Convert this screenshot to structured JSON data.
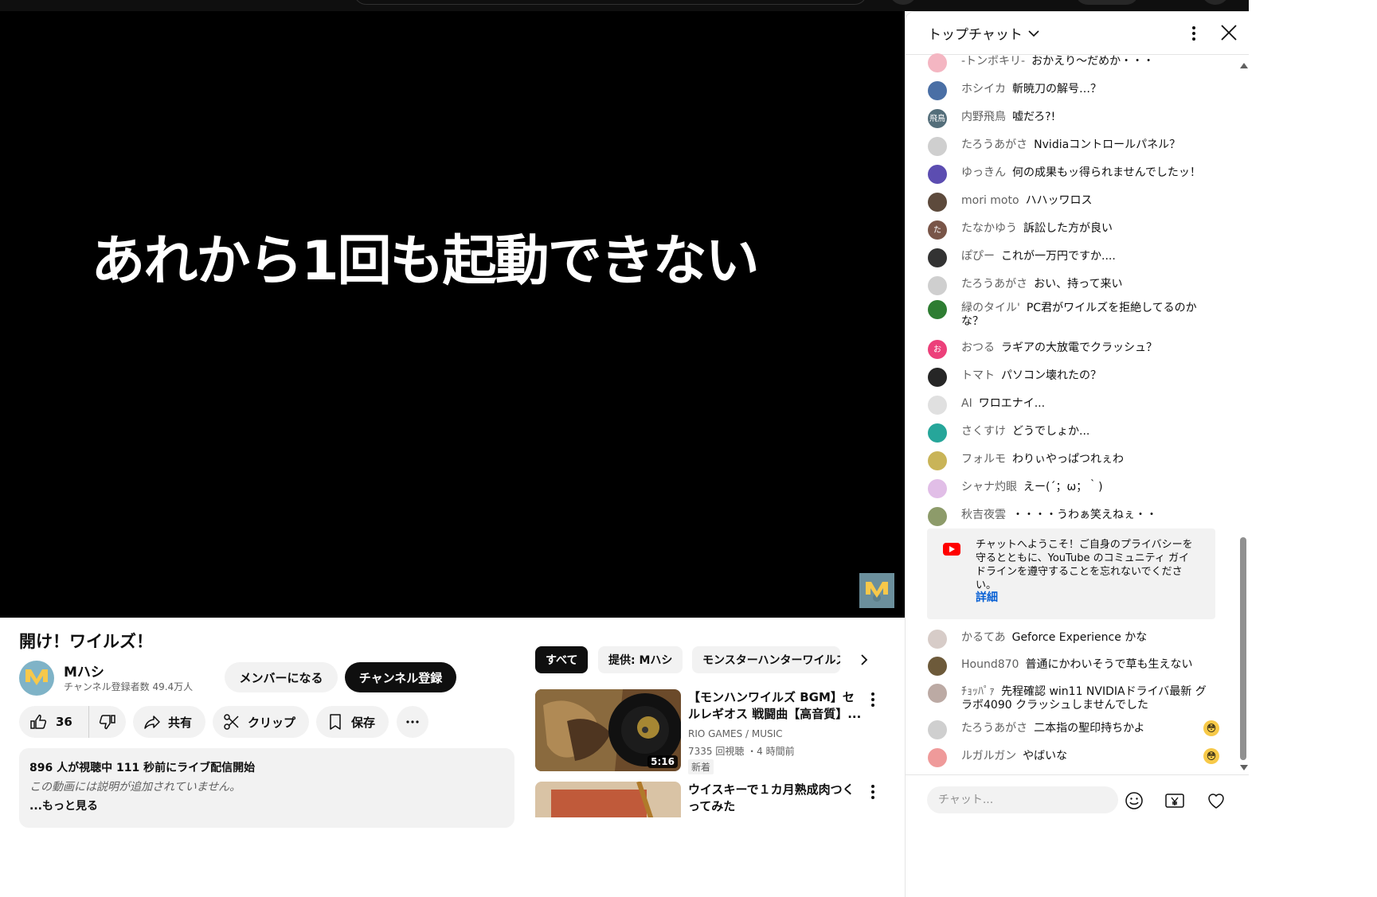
{
  "player": {
    "caption": "あれから1回も起動できない"
  },
  "video": {
    "title": "開け！ワイルズ！",
    "channel_name": "Mハシ",
    "subscribers": "チャンネル登録者数 49.4万人",
    "member_label": "メンバーになる",
    "subscribe_label": "チャンネル登録",
    "like_count": "36",
    "share_label": "共有",
    "clip_label": "クリップ",
    "save_label": "保存"
  },
  "description": {
    "stats": "896 人が視聴中  111 秒前にライブ配信開始",
    "text": "この動画には説明が追加されていません。",
    "more": "...もっと見る"
  },
  "chips": [
    "すべて",
    "提供: Mハシ",
    "モンスターハンターワイルズ"
  ],
  "related": [
    {
      "title": "【モンハンワイルズ BGM】セルレギオス 戦闘曲【高音質】...",
      "channel": "RIO GAMES / MUSIC",
      "meta": "7335 回視聴 ・4 時間前",
      "badge": "新着",
      "duration": "5:16"
    },
    {
      "title": "ウイスキーで１カ月熟成肉つくってみた",
      "channel": "",
      "meta": "",
      "badge": "",
      "duration": ""
    }
  ],
  "chat": {
    "title": "トップチャット",
    "messages": [
      {
        "author": "-トンボキリ-",
        "text": "おかえり〜だめか・・・",
        "avatar_color": "#f4b6c2",
        "avatar_text": ""
      },
      {
        "author": "ホシイカ",
        "text": "斬暁刀の解号…？",
        "avatar_color": "#4a6fa5",
        "avatar_text": ""
      },
      {
        "author": "内野飛鳥",
        "text": "嘘だろ?!",
        "avatar_color": "#546e7a",
        "avatar_text": "飛鳥"
      },
      {
        "author": "たろうあがさ",
        "text": "Nvidiaコントロールパネル？",
        "avatar_color": "#cfcfcf",
        "avatar_text": ""
      },
      {
        "author": "ゆっきん",
        "text": "何の成果もッ得られませんでしたッ！",
        "avatar_color": "#5c4db1",
        "avatar_text": ""
      },
      {
        "author": "mori moto",
        "text": "ハハッワロス",
        "avatar_color": "#5d4a3c",
        "avatar_text": ""
      },
      {
        "author": "たなかゆう",
        "text": "訴訟した方が良い",
        "avatar_color": "#795548",
        "avatar_text": "た"
      },
      {
        "author": "ぽぴー",
        "text": "これが一万円ですか....",
        "avatar_color": "#333333",
        "avatar_text": ""
      },
      {
        "author": "たろうあがさ",
        "text": "おい、持って来い",
        "avatar_color": "#cfcfcf",
        "avatar_text": ""
      },
      {
        "author": "緑のタイル'",
        "text": "PC君がワイルズを拒絶してるのかな？",
        "avatar_color": "#2e7d32",
        "avatar_text": ""
      },
      {
        "author": "おつる",
        "text": "ラギアの大放電でクラッシュ？",
        "avatar_color": "#ec407a",
        "avatar_text": "お"
      },
      {
        "author": "トマト",
        "text": "パソコン壊れたの？",
        "avatar_color": "#262626",
        "avatar_text": ""
      },
      {
        "author": "AI",
        "text": "ワロエナイ...",
        "avatar_color": "#e0e0e0",
        "avatar_text": ""
      },
      {
        "author": "さくすけ",
        "text": "どうでしょか...",
        "avatar_color": "#26a69a",
        "avatar_text": ""
      },
      {
        "author": "フォルモ",
        "text": "わりぃやっぱつれぇわ",
        "avatar_color": "#c9b458",
        "avatar_text": ""
      },
      {
        "author": "シャナ灼眼",
        "text": "えー(´；ω；｀)",
        "avatar_color": "#e1bee7",
        "avatar_text": ""
      },
      {
        "author": "秋吉夜雲",
        "text": "・・・・うわぁ笑えねぇ・・",
        "avatar_color": "#8d9b6a",
        "avatar_text": ""
      }
    ],
    "welcome_text": "チャットへようこそ！ご自身のプライバシーを守るとともに、YouTube のコミュニティ ガイドラインを遵守することを忘れないでください。",
    "welcome_more": "詳細",
    "messages_after": [
      {
        "author": "かるてあ",
        "text": "Geforce Experience かな",
        "avatar_color": "#d7ccc8",
        "avatar_text": "",
        "emoji": ""
      },
      {
        "author": "Hound870",
        "text": "普通にかわいそうで草も生えない",
        "avatar_color": "#6d5a3a",
        "avatar_text": "",
        "emoji": ""
      },
      {
        "author": "ﾁｮｯﾊﾟｧ",
        "text": "先程確認 win11 NVIDIAドライバ最新 グラボ4090 クラッシュしませんでした",
        "avatar_color": "#bcaaa4",
        "avatar_text": "",
        "emoji": ""
      },
      {
        "author": "たろうあがさ",
        "text": "二本指の聖印持ちかよ",
        "avatar_color": "#cfcfcf",
        "avatar_text": "",
        "emoji": "😳"
      },
      {
        "author": "ルガルガン",
        "text": "やばいな",
        "avatar_color": "#ef9a9a",
        "avatar_text": "",
        "emoji": "😳"
      }
    ],
    "input_placeholder": "チャット..."
  }
}
